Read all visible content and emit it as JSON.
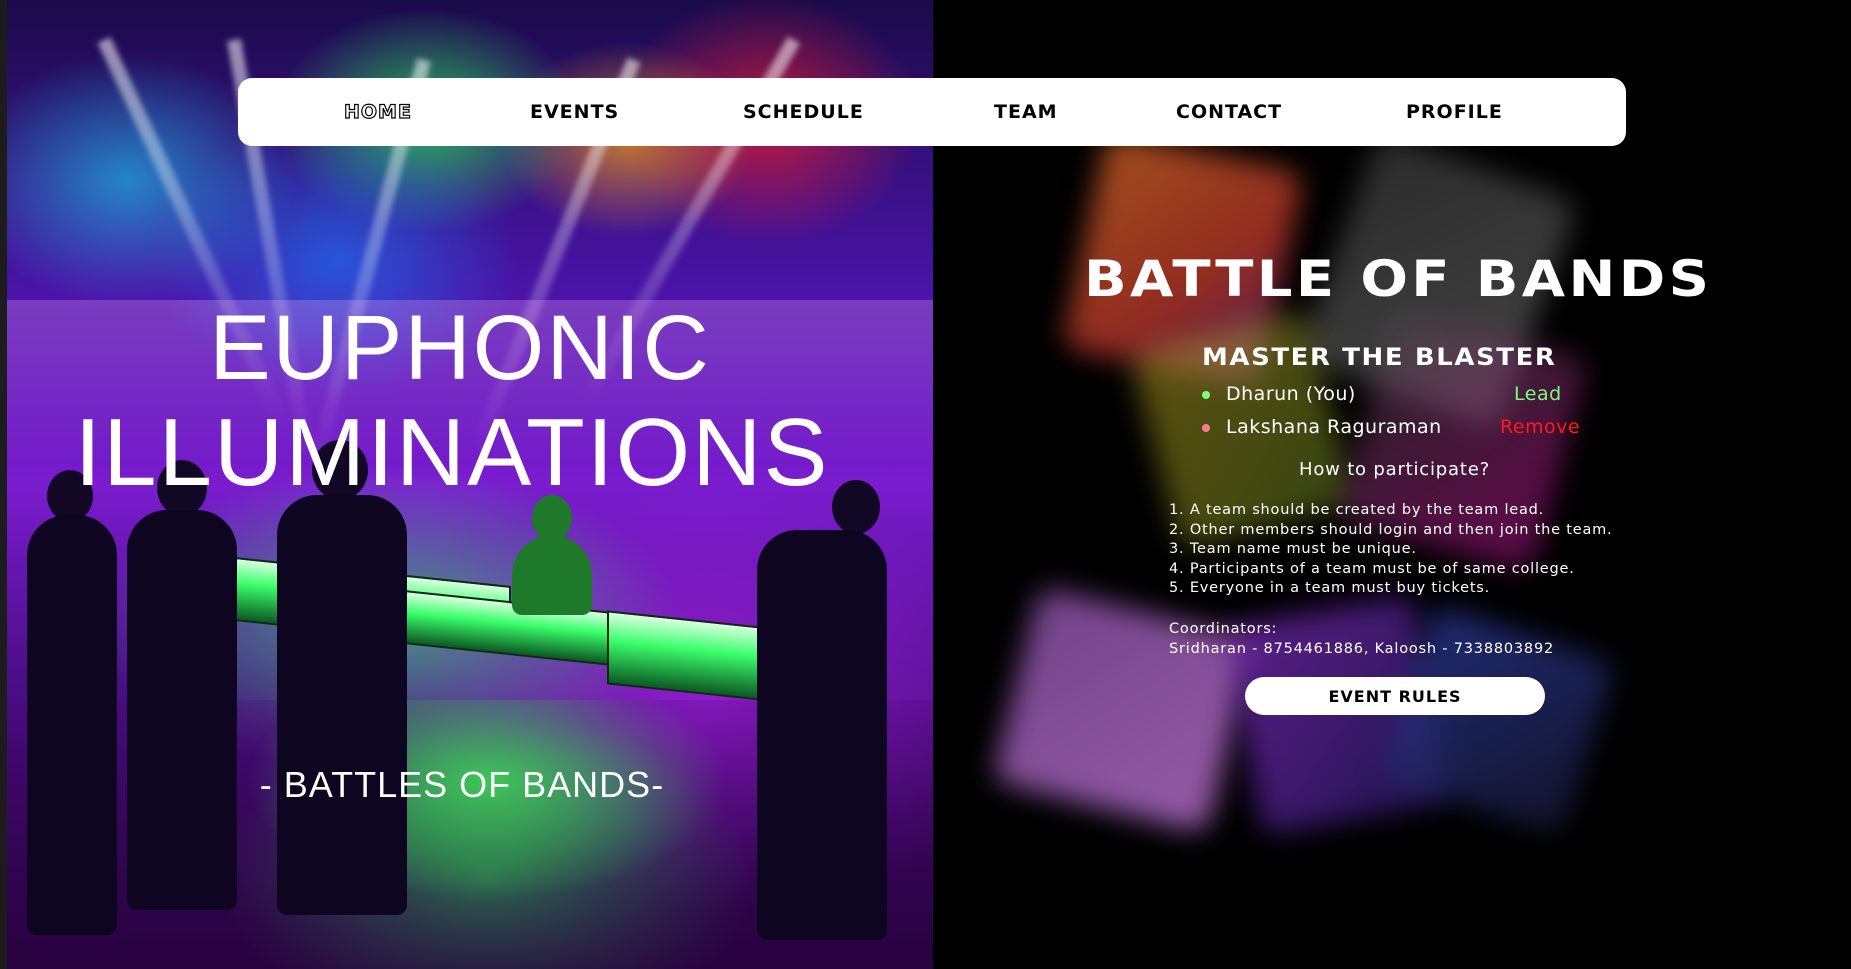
{
  "nav": {
    "items": [
      {
        "label": "HOME",
        "active": true
      },
      {
        "label": "EVENTS",
        "active": false
      },
      {
        "label": "SCHEDULE",
        "active": false
      },
      {
        "label": "TEAM",
        "active": false
      },
      {
        "label": "CONTACT",
        "active": false
      },
      {
        "label": "PROFILE",
        "active": false
      }
    ]
  },
  "poster": {
    "title_line1": "EUPHONIC",
    "title_line2": "ILLUMINATIONS",
    "subtitle": "- BATTLES OF BANDS-"
  },
  "event": {
    "title": "BATTLE OF BANDS",
    "team_name": "MASTER THE BLASTER",
    "members": [
      {
        "name": "Dharun (You)",
        "role": "Lead",
        "dot_color": "#7CFC7C",
        "role_color": "#7CFC7C"
      },
      {
        "name": "Lakshana Raguraman",
        "role": "Remove",
        "dot_color": "#ff7a8a",
        "role_color": "#ff1a1a"
      }
    ],
    "how_heading": "How to participate?",
    "rules": [
      "1. A team should be created by the team lead.",
      "2. Other members should login and then join the team.",
      "3. Team name must be unique.",
      "4. Participants of a team must be of same college.",
      "5. Everyone in a team must buy tickets."
    ],
    "coordinators_label": "Coordinators:",
    "coordinators_value": "Sridharan - 8754461886, Kaloosh - 7338803892",
    "rules_button": "EVENT RULES"
  },
  "colors": {
    "background": "#000000",
    "navbar_bg": "#ffffff",
    "lead_green": "#7CFC7C",
    "remove_red": "#ff1a1a"
  }
}
